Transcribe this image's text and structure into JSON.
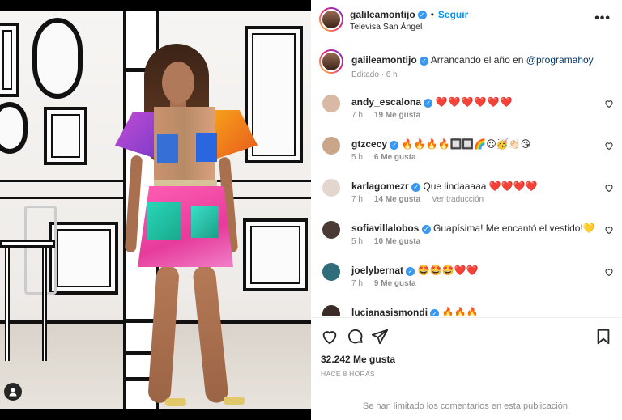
{
  "post": {
    "author": "galileamontijo",
    "follow_label": "Seguir",
    "location": "Televisa San Ángel",
    "caption_user": "galileamontijo",
    "caption_text": "Arrancando el año en",
    "caption_mention": "@programahoy",
    "caption_meta": "Editado · 6 h",
    "likes": "32.242 Me gusta",
    "timestamp": "HACE 8 HORAS",
    "comments_disabled_notice": "Se han limitado los comentarios en esta publicación."
  },
  "comments": [
    {
      "user": "andy_escalona",
      "text": "❤️❤️❤️❤️❤️❤️",
      "age": "7 h",
      "likes": "19 Me gusta",
      "translate": "",
      "avatar_color": "#d9b8a6"
    },
    {
      "user": "gtzcecy",
      "text": "🔥🔥🔥🔥🔲🔲🌈😍🥳👏🏻😘",
      "age": "5 h",
      "likes": "6 Me gusta",
      "translate": "",
      "avatar_color": "#c9a58a"
    },
    {
      "user": "karlagomezr",
      "text": "Que lindaaaaa ❤️❤️❤️❤️",
      "age": "7 h",
      "likes": "14 Me gusta",
      "translate": "Ver traducción",
      "avatar_color": "#e3d6cf"
    },
    {
      "user": "sofiavillalobos",
      "text": "Guapísima! Me encantó el vestido!💛",
      "age": "5 h",
      "likes": "10 Me gusta",
      "translate": "",
      "avatar_color": "#4a3a36"
    },
    {
      "user": "joelybernat",
      "text": "🤩🤩🤩❤️❤️",
      "age": "7 h",
      "likes": "9 Me gusta",
      "translate": "",
      "avatar_color": "#2f6d7a"
    },
    {
      "user": "lucianasismondi",
      "text": "🔥🔥🔥",
      "age": "",
      "likes": "",
      "translate": "",
      "avatar_color": "#3b2b27"
    }
  ],
  "icons": {
    "verified": "verified-badge-icon",
    "more": "more-options-icon",
    "like": "heart-icon",
    "comment": "comment-icon",
    "share": "share-icon",
    "save": "bookmark-icon",
    "tag": "user-tag-icon"
  },
  "colors": {
    "accent": "#0095f6",
    "verified": "#3897f0",
    "secondary_text": "#8e8e8e",
    "mention": "#00376b"
  }
}
